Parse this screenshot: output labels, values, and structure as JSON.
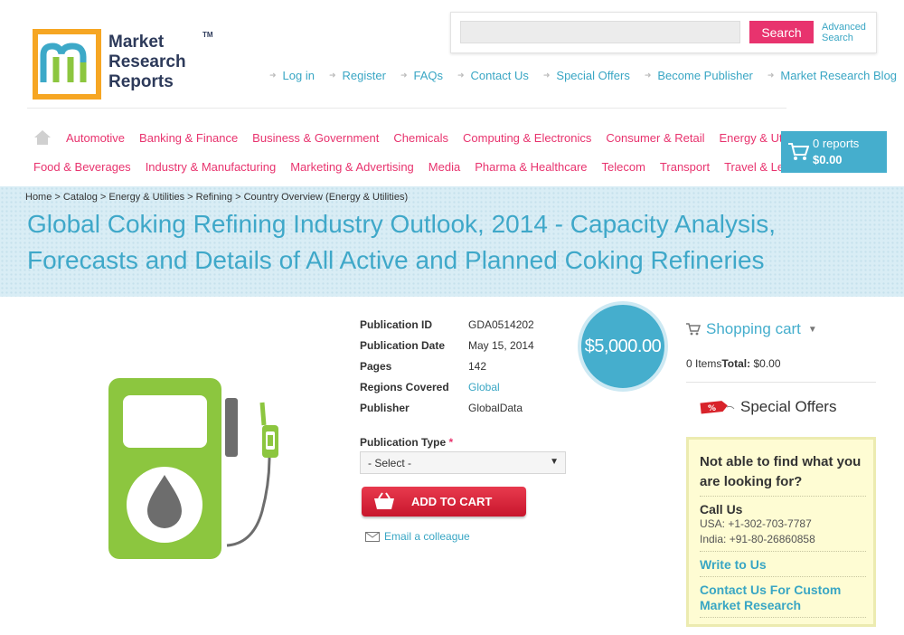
{
  "logo": {
    "line1": "Market",
    "line2": "Research",
    "line3": "Reports",
    "tm": "TM"
  },
  "search": {
    "placeholder": "",
    "button": "Search",
    "advanced1": "Advanced",
    "advanced2": "Search"
  },
  "top_links": [
    "Log in",
    "Register",
    "FAQs",
    "Contact Us",
    "Special Offers",
    "Become Publisher",
    "Market Research Blog"
  ],
  "categories_row1": [
    "Automotive",
    "Banking & Finance",
    "Business & Government",
    "Chemicals",
    "Computing & Electronics",
    "Consumer & Retail",
    "Energy & Utilities"
  ],
  "categories_row2": [
    "Food & Beverages",
    "Industry & Manufacturing",
    "Marketing & Advertising",
    "Media",
    "Pharma & Healthcare",
    "Telecom",
    "Transport",
    "Travel & Leisure"
  ],
  "cart": {
    "reports": "0 reports",
    "total": "$0.00"
  },
  "breadcrumb": [
    "Home",
    "Catalog",
    "Energy & Utilities",
    "Refining",
    "Country Overview (Energy & Utilities)"
  ],
  "title": "Global Coking Refining Industry Outlook, 2014 - Capacity Analysis, Forecasts and Details of All Active and Planned Coking Refineries",
  "details": [
    {
      "label": "Publication ID",
      "value": "GDA0514202"
    },
    {
      "label": "Publication Date",
      "value": "May 15, 2014"
    },
    {
      "label": "Pages",
      "value": "142"
    },
    {
      "label": "Regions Covered",
      "value": "Global"
    },
    {
      "label": "Publisher",
      "value": "GlobalData"
    }
  ],
  "price": "$5,000.00",
  "publication_type": {
    "label": "Publication Type",
    "required": "*",
    "selected": "- Select -"
  },
  "add_to_cart": "ADD TO CART",
  "email_colleague": "Email a colleague",
  "shopping_cart": {
    "title": "Shopping cart",
    "items": "0 Items",
    "total_label": "Total:",
    "total": "$0.00"
  },
  "special_offers": "Special Offers",
  "help": {
    "question": "Not able to find what you are looking for?",
    "call_us": "Call Us",
    "usa": "USA: +1-302-703-7787",
    "india": "India: +91-80-26860858",
    "write": "Write to Us",
    "custom": "Contact Us For Custom Market Research"
  },
  "colors": {
    "accent_blue": "#45aecd",
    "accent_pink": "#e8336e",
    "title_blue": "#3fa8c9",
    "pump_green": "#8cc63f"
  },
  "icons": [
    "home-icon",
    "cart-icon",
    "fuel-pump-icon",
    "oil-drop-icon",
    "basket-icon",
    "envelope-icon",
    "special-offer-tag-icon"
  ]
}
